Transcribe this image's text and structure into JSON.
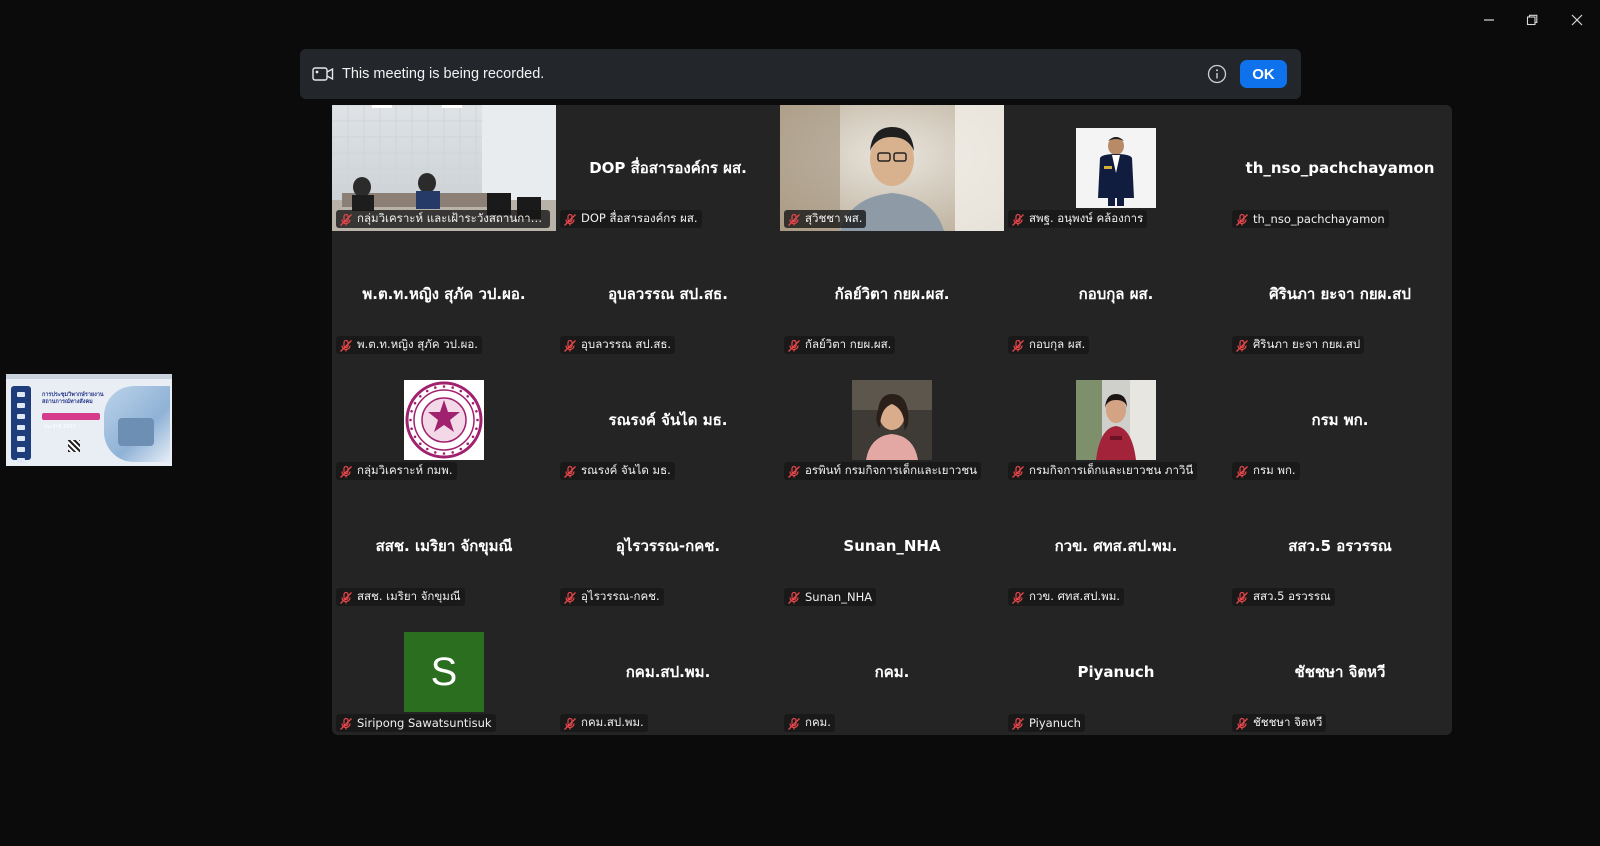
{
  "window": {
    "minimize_icon": "minimize-icon",
    "maximize_icon": "restore-icon",
    "close_icon": "close-icon"
  },
  "banner": {
    "text": "This meeting is being recorded.",
    "ok_label": "OK",
    "icon": "video-record-icon",
    "info_icon": "info-icon"
  },
  "share_thumbnail": {
    "title_line1": "การประชุมวิพากษ์รายงาน",
    "title_line2": "สถานการณ์ทางสังคม",
    "title_line3": "ประจำปี 2567"
  },
  "tiles": [
    {
      "label": "กลุ่มวิเคราะห์ และเฝ้าระวังสถานการณ์ทางสังคม",
      "display": "",
      "type": "video-room",
      "active": true
    },
    {
      "label": "DOP สื่อสารองค์กร ผส.",
      "display": "DOP สื่อสารองค์กร ผส.",
      "type": "name"
    },
    {
      "label": "สุวิชชา พส.",
      "display": "",
      "type": "video-person"
    },
    {
      "label": "สพฐ. อนุพงษ์ คล้องการ",
      "display": "",
      "type": "photo-man"
    },
    {
      "label": "th_nso_pachchayamon",
      "display": "th_nso_pachchayamon",
      "type": "name"
    },
    {
      "label": "พ.ต.ท.หญิง สุภัค วป.ผอ.",
      "display": "พ.ต.ท.หญิง สุภัค วป.ผอ.",
      "type": "name"
    },
    {
      "label": "อุบลวรรณ สป.สธ.",
      "display": "อุบลวรรณ สป.สธ.",
      "type": "name"
    },
    {
      "label": "กัลย์วิตา กยผ.ผส.",
      "display": "กัลย์วิตา กยผ.ผส.",
      "type": "name"
    },
    {
      "label": "กอบกุล ผส.",
      "display": "กอบกุล ผส.",
      "type": "name"
    },
    {
      "label": "ศิรินภา ยะจา กยผ.สป",
      "display": "ศิรินภา ยะจา กยผ.สป",
      "type": "name"
    },
    {
      "label": "กลุ่มวิเคราะห์ กมพ.",
      "display": "",
      "type": "seal"
    },
    {
      "label": "รณรงค์ จันได มธ.",
      "display": "รณรงค์ จันได มธ.",
      "type": "name"
    },
    {
      "label": "อรพินท์ กรมกิจการเด็กและเยาวชน",
      "display": "",
      "type": "photo-woman1"
    },
    {
      "label": "กรมกิจการเด็กและเยาวชน ภาวินี",
      "display": "",
      "type": "photo-woman2"
    },
    {
      "label": "กรม พก.",
      "display": "กรม พก.",
      "type": "name"
    },
    {
      "label": "สสช. เมริยา จักขุมณี",
      "display": "สสช. เมริยา จักขุมณี",
      "type": "name"
    },
    {
      "label": "อุไรวรรณ-กคช.",
      "display": "อุไรวรรณ-กคช.",
      "type": "name"
    },
    {
      "label": "Sunan_NHA",
      "display": "Sunan_NHA",
      "type": "name"
    },
    {
      "label": "กวข. ศทส.สป.พม.",
      "display": "กวข. ศทส.สป.พม.",
      "type": "name"
    },
    {
      "label": "สสว.5 อรวรรณ",
      "display": "สสว.5 อรวรรณ",
      "type": "name"
    },
    {
      "label": "Siripong Sawatsuntisuk",
      "display": "",
      "type": "letter",
      "letter": "S"
    },
    {
      "label": "กคม.สป.พม.",
      "display": "กคม.สป.พม.",
      "type": "name"
    },
    {
      "label": "กคม.",
      "display": "กคม.",
      "type": "name"
    },
    {
      "label": "Piyanuch",
      "display": "Piyanuch",
      "type": "name"
    },
    {
      "label": "ชัชชษา จิตหวี",
      "display": "ชัชชษา จิตหวี",
      "type": "name"
    }
  ],
  "colors": {
    "active_speaker": "#23d959",
    "ok_button": "#0e72ed",
    "muted_mic": "#e8474b",
    "avatar_letter_bg": "#2c6e1f"
  }
}
